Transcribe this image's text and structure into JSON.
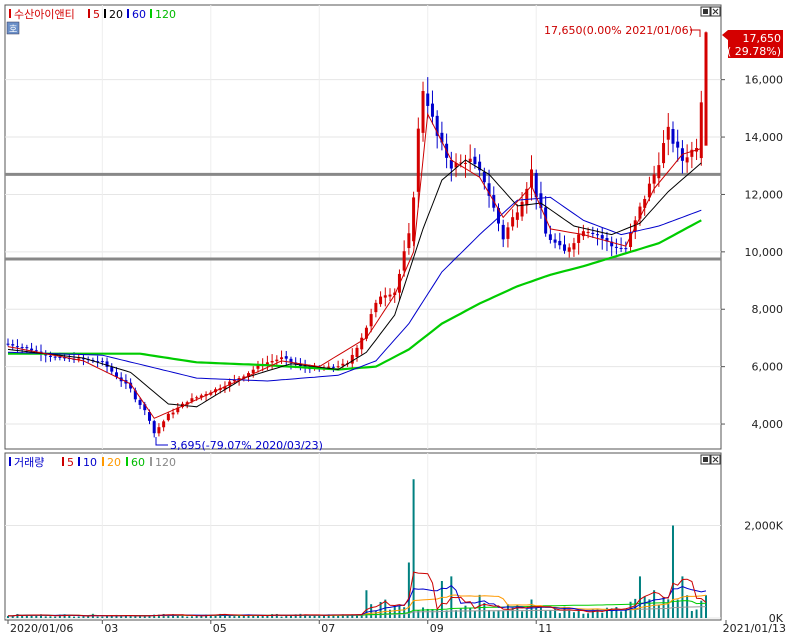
{
  "price_legend": {
    "stock_name": "수산아이앤티",
    "ma5": "5",
    "ma20": "20",
    "ma60": "60",
    "ma120": "120"
  },
  "volume_legend": {
    "title": "거래량",
    "ma5": "5",
    "ma10": "10",
    "ma20": "20",
    "ma60": "60",
    "ma120": "120"
  },
  "annotations": {
    "high": "17,650(0.00% 2021/01/06)",
    "low": "3,695(-79.07% 2020/03/23)",
    "last_price": "17,650",
    "last_change": "( 29.78%)"
  },
  "colors": {
    "up": "#d40000",
    "down": "#0000cc",
    "ma5": "#cc0000",
    "ma20": "#000000",
    "ma60": "#0000cc",
    "ma120": "#00cc00",
    "vma20": "#ff9900",
    "vma120": "#999999"
  },
  "chart_data": [
    {
      "type": "candlestick",
      "title": "수산아이앤티",
      "x_tick_labels": [
        "2020/01/06",
        "03",
        "05",
        "07",
        "09",
        "11",
        "2021/01/13"
      ],
      "y_tick_labels": [
        "4,000",
        "6,000",
        "8,000",
        "10,000",
        "12,000",
        "14,000",
        "16,000"
      ],
      "ylim": [
        3200,
        17800
      ],
      "series": [
        {
          "name": "5",
          "type": "line",
          "color": "#cc0000"
        },
        {
          "name": "20",
          "type": "line",
          "color": "#000000"
        },
        {
          "name": "60",
          "type": "line",
          "color": "#0000cc"
        },
        {
          "name": "120",
          "type": "line",
          "color": "#00cc00"
        }
      ],
      "horizontal_lines": [
        12700,
        9750
      ],
      "price_path": [
        [
          0,
          6800
        ],
        [
          6,
          6550
        ],
        [
          10,
          6300
        ],
        [
          16,
          6250
        ],
        [
          20,
          6150
        ],
        [
          26,
          5200
        ],
        [
          30,
          4200
        ],
        [
          31,
          3695
        ],
        [
          34,
          4300
        ],
        [
          38,
          4800
        ],
        [
          44,
          5200
        ],
        [
          50,
          5700
        ],
        [
          54,
          6100
        ],
        [
          58,
          6300
        ],
        [
          62,
          6000
        ],
        [
          66,
          5900
        ],
        [
          72,
          6100
        ],
        [
          76,
          7400
        ],
        [
          79,
          8500
        ],
        [
          82,
          8600
        ],
        [
          85,
          10500
        ],
        [
          88,
          15800
        ],
        [
          91,
          14000
        ],
        [
          94,
          13000
        ],
        [
          98,
          13200
        ],
        [
          101,
          12500
        ],
        [
          105,
          10500
        ],
        [
          108,
          11500
        ],
        [
          111,
          12800
        ],
        [
          114,
          10600
        ],
        [
          118,
          10000
        ],
        [
          122,
          10800
        ],
        [
          125,
          10600
        ],
        [
          128,
          10200
        ],
        [
          131,
          10100
        ],
        [
          134,
          11500
        ],
        [
          137,
          12700
        ],
        [
          140,
          14200
        ],
        [
          143,
          13200
        ],
        [
          146,
          13700
        ],
        [
          148,
          17650
        ]
      ],
      "ma5_path": [
        [
          0,
          6700
        ],
        [
          16,
          6200
        ],
        [
          26,
          5400
        ],
        [
          31,
          4200
        ],
        [
          38,
          4700
        ],
        [
          50,
          5600
        ],
        [
          58,
          6200
        ],
        [
          66,
          6000
        ],
        [
          76,
          7000
        ],
        [
          82,
          8500
        ],
        [
          86,
          10000
        ],
        [
          89,
          14800
        ],
        [
          94,
          13200
        ],
        [
          100,
          12600
        ],
        [
          105,
          11200
        ],
        [
          111,
          12300
        ],
        [
          115,
          10800
        ],
        [
          122,
          10600
        ],
        [
          131,
          10200
        ],
        [
          137,
          12200
        ],
        [
          143,
          13400
        ],
        [
          147,
          13600
        ]
      ],
      "ma20_path": [
        [
          0,
          6600
        ],
        [
          16,
          6300
        ],
        [
          26,
          5800
        ],
        [
          34,
          4700
        ],
        [
          40,
          4600
        ],
        [
          50,
          5600
        ],
        [
          60,
          6100
        ],
        [
          70,
          5900
        ],
        [
          76,
          6500
        ],
        [
          82,
          7800
        ],
        [
          88,
          10800
        ],
        [
          92,
          12500
        ],
        [
          97,
          13200
        ],
        [
          102,
          12700
        ],
        [
          108,
          11600
        ],
        [
          113,
          11700
        ],
        [
          120,
          10900
        ],
        [
          128,
          10600
        ],
        [
          134,
          11000
        ],
        [
          140,
          12100
        ],
        [
          147,
          13100
        ]
      ],
      "ma60_path": [
        [
          0,
          6500
        ],
        [
          20,
          6400
        ],
        [
          30,
          6000
        ],
        [
          40,
          5600
        ],
        [
          55,
          5500
        ],
        [
          70,
          5700
        ],
        [
          78,
          6200
        ],
        [
          85,
          7500
        ],
        [
          92,
          9300
        ],
        [
          100,
          10600
        ],
        [
          108,
          11800
        ],
        [
          115,
          11900
        ],
        [
          122,
          11100
        ],
        [
          130,
          10600
        ],
        [
          138,
          10900
        ],
        [
          147,
          11450
        ]
      ],
      "ma120_path": [
        [
          0,
          6450
        ],
        [
          28,
          6450
        ],
        [
          40,
          6150
        ],
        [
          55,
          6050
        ],
        [
          70,
          5900
        ],
        [
          78,
          6000
        ],
        [
          85,
          6600
        ],
        [
          92,
          7500
        ],
        [
          100,
          8200
        ],
        [
          108,
          8800
        ],
        [
          115,
          9200
        ],
        [
          122,
          9500
        ],
        [
          130,
          9900
        ],
        [
          138,
          10300
        ],
        [
          147,
          11100
        ]
      ]
    },
    {
      "type": "bar",
      "title": "거래량",
      "y_tick_labels": [
        "0K",
        "2,000K"
      ],
      "ylim": [
        0,
        3200
      ],
      "spikes": [
        [
          76,
          600
        ],
        [
          85,
          1200
        ],
        [
          86,
          3000
        ],
        [
          92,
          800
        ],
        [
          94,
          900
        ],
        [
          100,
          500
        ],
        [
          111,
          400
        ],
        [
          134,
          900
        ],
        [
          137,
          600
        ],
        [
          141,
          2000
        ],
        [
          143,
          900
        ]
      ],
      "series": [
        {
          "name": "5",
          "color": "#cc0000"
        },
        {
          "name": "10",
          "color": "#0000cc"
        },
        {
          "name": "20",
          "color": "#ff9900"
        },
        {
          "name": "60",
          "color": "#00cc00"
        },
        {
          "name": "120",
          "color": "#999999"
        }
      ]
    }
  ]
}
